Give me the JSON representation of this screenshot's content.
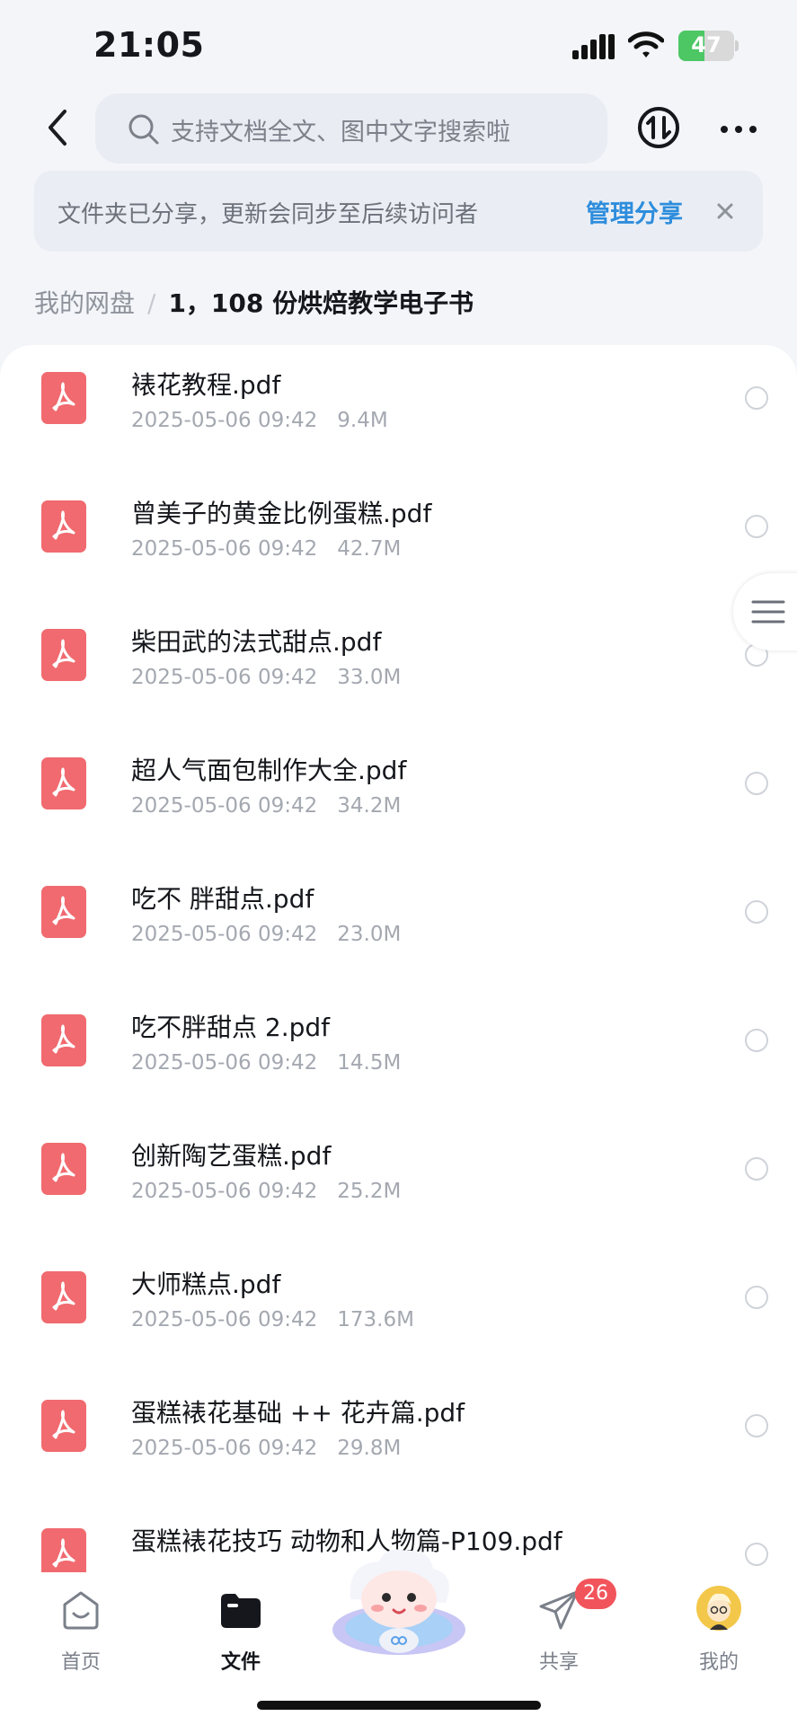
{
  "status": {
    "time": "21:05",
    "battery": "47",
    "battery_level": 0.47
  },
  "header": {
    "search_placeholder": "支持文档全文、图中文字搜索啦"
  },
  "banner": {
    "message": "文件夹已分享，更新会同步至后续访问者",
    "manage_label": "管理分享"
  },
  "breadcrumb": {
    "root": "我的网盘",
    "separator": "/",
    "current": "1，108 份烘焙教学电子书"
  },
  "files": [
    {
      "name": "裱花教程.pdf",
      "date": "2025-05-06 09:42",
      "size": "9.4M"
    },
    {
      "name": "曾美子的黄金比例蛋糕.pdf",
      "date": "2025-05-06 09:42",
      "size": "42.7M"
    },
    {
      "name": "柴田武的法式甜点.pdf",
      "date": "2025-05-06 09:42",
      "size": "33.0M"
    },
    {
      "name": "超人气面包制作大全.pdf",
      "date": "2025-05-06 09:42",
      "size": "34.2M"
    },
    {
      "name": "吃不 胖甜点.pdf",
      "date": "2025-05-06 09:42",
      "size": "23.0M"
    },
    {
      "name": "吃不胖甜点 2.pdf",
      "date": "2025-05-06 09:42",
      "size": "14.5M"
    },
    {
      "name": "创新陶艺蛋糕.pdf",
      "date": "2025-05-06 09:42",
      "size": "25.2M"
    },
    {
      "name": "大师糕点.pdf",
      "date": "2025-05-06 09:42",
      "size": "173.6M"
    },
    {
      "name": "蛋糕裱花基础 ++ 花卉篇.pdf",
      "date": "2025-05-06 09:42",
      "size": "29.8M"
    },
    {
      "name": "蛋糕裱花技巧 动物和人物篇-P109.pdf",
      "date": "",
      "size": ""
    }
  ],
  "tabbar": {
    "home": "首页",
    "files": "文件",
    "share": "共享",
    "share_badge": "26",
    "mine": "我的"
  },
  "colors": {
    "accent": "#2e8ddc",
    "pdf": "#f06a6f",
    "badge": "#f2545b",
    "battery": "#4cc764"
  }
}
